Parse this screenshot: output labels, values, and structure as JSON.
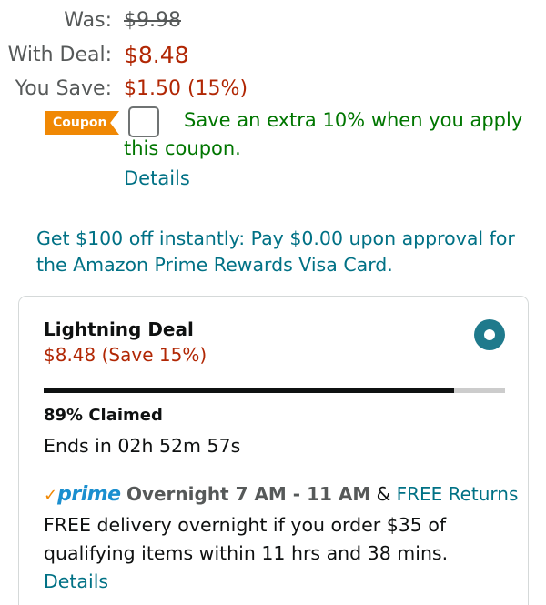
{
  "pricing": {
    "was_label": "Was:",
    "was_value": "$9.98",
    "deal_label": "With Deal:",
    "deal_value": "$8.48",
    "save_label": "You Save:",
    "save_value": "$1.50 (15%)"
  },
  "coupon": {
    "badge": "Coupon",
    "text": "Save an extra 10% when you apply this coupon.",
    "details": "Details",
    "checked": false
  },
  "promo": {
    "text": "Get $100 off instantly: Pay $0.00 upon approval for the Amazon Prime Rewards Visa Card."
  },
  "lightning_deal": {
    "title": "Lightning Deal",
    "price": "$8.48 (Save 15%)",
    "selected": true,
    "claimed_text": "89% Claimed",
    "claimed_fraction": 0.89,
    "ends_text": "Ends in 02h 52m 57s"
  },
  "delivery": {
    "prime_check": "✓",
    "prime_word": "prime",
    "window": "Overnight 7 AM - 11 AM",
    "amp": "&",
    "free_returns": "FREE Returns",
    "description": "FREE delivery overnight if you order $35 of qualifying items within 11 hrs and 38 mins.",
    "details": "Details"
  },
  "colors": {
    "price_red": "#b12704",
    "link_teal": "#007185",
    "coupon_orange": "#f08804",
    "coupon_green": "#007600",
    "prime_blue": "#1b8fcf",
    "radio_teal": "#1f7a8c"
  }
}
